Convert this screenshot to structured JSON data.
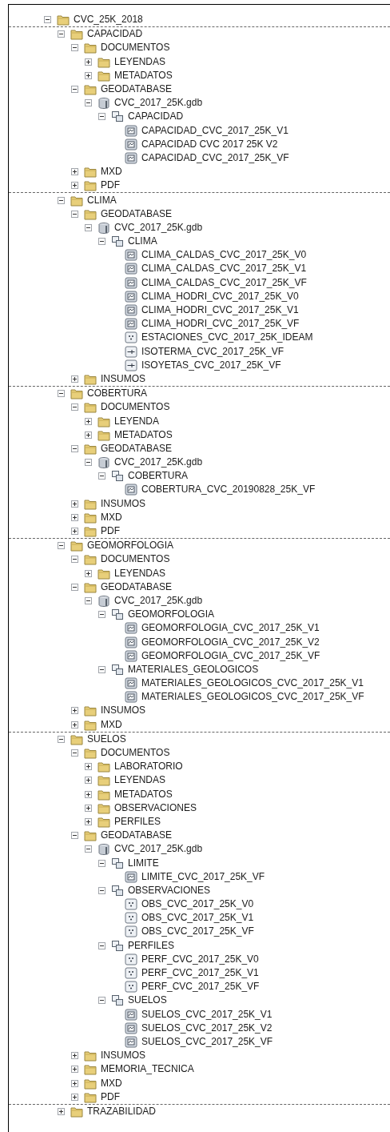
{
  "tree": {
    "label": "CVC_25K_2018",
    "kind": "folder",
    "expanded": true,
    "children": [
      {
        "label": "CAPACIDAD",
        "kind": "folder",
        "expanded": true,
        "children": [
          {
            "label": "DOCUMENTOS",
            "kind": "folder",
            "expanded": true,
            "children": [
              {
                "label": "LEYENDAS",
                "kind": "folder",
                "expanded": false
              },
              {
                "label": "METADATOS",
                "kind": "folder",
                "expanded": false
              }
            ]
          },
          {
            "label": "GEODATABASE",
            "kind": "folder",
            "expanded": true,
            "children": [
              {
                "label": "CVC_2017_25K.gdb",
                "kind": "geodatabase",
                "expanded": true,
                "children": [
                  {
                    "label": "CAPACIDAD",
                    "kind": "dataset",
                    "expanded": true,
                    "children": [
                      {
                        "label": "CAPACIDAD_CVC_2017_25K_V1",
                        "kind": "polygon"
                      },
                      {
                        "label": "CAPACIDAD CVC 2017 25K V2",
                        "kind": "polygon"
                      },
                      {
                        "label": "CAPACIDAD_CVC_2017_25K_VF",
                        "kind": "polygon"
                      }
                    ]
                  }
                ]
              }
            ]
          },
          {
            "label": "MXD",
            "kind": "folder",
            "expanded": false
          },
          {
            "label": "PDF",
            "kind": "folder",
            "expanded": false
          }
        ]
      },
      {
        "label": "CLIMA",
        "kind": "folder",
        "expanded": true,
        "children": [
          {
            "label": "GEODATABASE",
            "kind": "folder",
            "expanded": true,
            "children": [
              {
                "label": "CVC_2017_25K.gdb",
                "kind": "geodatabase",
                "expanded": true,
                "children": [
                  {
                    "label": "CLIMA",
                    "kind": "dataset",
                    "expanded": true,
                    "children": [
                      {
                        "label": "CLIMA_CALDAS_CVC_2017_25K_V0",
                        "kind": "polygon"
                      },
                      {
                        "label": "CLIMA_CALDAS_CVC_2017_25K_V1",
                        "kind": "polygon"
                      },
                      {
                        "label": "CLIMA_CALDAS_CVC_2017_25K_VF",
                        "kind": "polygon"
                      },
                      {
                        "label": "CLIMA_HODRI_CVC_2017_25K_V0",
                        "kind": "polygon"
                      },
                      {
                        "label": "CLIMA_HODRI_CVC_2017_25K_V1",
                        "kind": "polygon"
                      },
                      {
                        "label": "CLIMA_HODRI_CVC_2017_25K_VF",
                        "kind": "polygon"
                      },
                      {
                        "label": "ESTACIONES_CVC_2017_25K_IDEAM",
                        "kind": "point"
                      },
                      {
                        "label": "ISOTERMA_CVC_2017_25K_VF",
                        "kind": "line"
                      },
                      {
                        "label": "ISOYETAS_CVC_2017_25K_VF",
                        "kind": "line"
                      }
                    ]
                  }
                ]
              }
            ]
          },
          {
            "label": "INSUMOS",
            "kind": "folder",
            "expanded": false
          }
        ]
      },
      {
        "label": "COBERTURA",
        "kind": "folder",
        "expanded": true,
        "children": [
          {
            "label": "DOCUMENTOS",
            "kind": "folder",
            "expanded": true,
            "children": [
              {
                "label": "LEYENDA",
                "kind": "folder",
                "expanded": false
              },
              {
                "label": "METADATOS",
                "kind": "folder",
                "expanded": false
              }
            ]
          },
          {
            "label": "GEODATABASE",
            "kind": "folder",
            "expanded": true,
            "children": [
              {
                "label": "CVC_2017_25K.gdb",
                "kind": "geodatabase",
                "expanded": true,
                "children": [
                  {
                    "label": "COBERTURA",
                    "kind": "dataset",
                    "expanded": true,
                    "children": [
                      {
                        "label": "COBERTURA_CVC_20190828_25K_VF",
                        "kind": "polygon"
                      }
                    ]
                  }
                ]
              }
            ]
          },
          {
            "label": "INSUMOS",
            "kind": "folder",
            "expanded": false
          },
          {
            "label": "MXD",
            "kind": "folder",
            "expanded": false
          },
          {
            "label": "PDF",
            "kind": "folder",
            "expanded": false
          }
        ]
      },
      {
        "label": "GEOMORFOLOGIA",
        "kind": "folder",
        "expanded": true,
        "children": [
          {
            "label": "DOCUMENTOS",
            "kind": "folder",
            "expanded": true,
            "children": [
              {
                "label": "LEYENDAS",
                "kind": "folder",
                "expanded": false
              }
            ]
          },
          {
            "label": "GEODATABASE",
            "kind": "folder",
            "expanded": true,
            "children": [
              {
                "label": "CVC_2017_25K.gdb",
                "kind": "geodatabase",
                "expanded": true,
                "children": [
                  {
                    "label": "GEOMORFOLOGIA",
                    "kind": "dataset",
                    "expanded": true,
                    "children": [
                      {
                        "label": "GEOMORFOLOGIA_CVC_2017_25K_V1",
                        "kind": "polygon"
                      },
                      {
                        "label": "GEOMORFOLOGIA_CVC_2017_25K_V2",
                        "kind": "polygon"
                      },
                      {
                        "label": "GEOMORFOLOGIA_CVC_2017_25K_VF",
                        "kind": "polygon"
                      }
                    ]
                  },
                  {
                    "label": "MATERIALES_GEOLOGICOS",
                    "kind": "dataset",
                    "expanded": true,
                    "children": [
                      {
                        "label": "MATERIALES_GEOLOGICOS_CVC_2017_25K_V1",
                        "kind": "polygon"
                      },
                      {
                        "label": "MATERIALES_GEOLOGICOS_CVC_2017_25K_VF",
                        "kind": "polygon"
                      }
                    ]
                  }
                ]
              }
            ]
          },
          {
            "label": "INSUMOS",
            "kind": "folder",
            "expanded": false
          },
          {
            "label": "MXD",
            "kind": "folder",
            "expanded": false
          }
        ]
      },
      {
        "label": "SUELOS",
        "kind": "folder",
        "expanded": true,
        "children": [
          {
            "label": "DOCUMENTOS",
            "kind": "folder",
            "expanded": true,
            "children": [
              {
                "label": "LABORATORIO",
                "kind": "folder",
                "expanded": false
              },
              {
                "label": "LEYENDAS",
                "kind": "folder",
                "expanded": false
              },
              {
                "label": "METADATOS",
                "kind": "folder",
                "expanded": false
              },
              {
                "label": "OBSERVACIONES",
                "kind": "folder",
                "expanded": false
              },
              {
                "label": "PERFILES",
                "kind": "folder",
                "expanded": false
              }
            ]
          },
          {
            "label": "GEODATABASE",
            "kind": "folder",
            "expanded": true,
            "children": [
              {
                "label": "CVC_2017_25K.gdb",
                "kind": "geodatabase",
                "expanded": true,
                "children": [
                  {
                    "label": "LIMITE",
                    "kind": "dataset",
                    "expanded": true,
                    "children": [
                      {
                        "label": "LIMITE_CVC_2017_25K_VF",
                        "kind": "polygon"
                      }
                    ]
                  },
                  {
                    "label": "OBSERVACIONES",
                    "kind": "dataset",
                    "expanded": true,
                    "children": [
                      {
                        "label": "OBS_CVC_2017_25K_V0",
                        "kind": "point"
                      },
                      {
                        "label": "OBS_CVC_2017_25K_V1",
                        "kind": "point"
                      },
                      {
                        "label": "OBS_CVC_2017_25K_VF",
                        "kind": "point"
                      }
                    ]
                  },
                  {
                    "label": "PERFILES",
                    "kind": "dataset",
                    "expanded": true,
                    "children": [
                      {
                        "label": "PERF_CVC_2017_25K_V0",
                        "kind": "point"
                      },
                      {
                        "label": "PERF_CVC_2017_25K_V1",
                        "kind": "point"
                      },
                      {
                        "label": "PERF_CVC_2017_25K_VF",
                        "kind": "point"
                      }
                    ]
                  },
                  {
                    "label": "SUELOS",
                    "kind": "dataset",
                    "expanded": true,
                    "children": [
                      {
                        "label": "SUELOS_CVC_2017_25K_V1",
                        "kind": "polygon"
                      },
                      {
                        "label": "SUELOS_CVC_2017_25K_V2",
                        "kind": "polygon"
                      },
                      {
                        "label": "SUELOS_CVC_2017_25K_VF",
                        "kind": "polygon"
                      }
                    ]
                  }
                ]
              }
            ]
          },
          {
            "label": "INSUMOS",
            "kind": "folder",
            "expanded": false
          },
          {
            "label": "MEMORIA_TECNICA",
            "kind": "folder",
            "expanded": false
          },
          {
            "label": "MXD",
            "kind": "folder",
            "expanded": false
          },
          {
            "label": "PDF",
            "kind": "folder",
            "expanded": false
          }
        ]
      },
      {
        "label": "TRAZABILIDAD",
        "kind": "folder",
        "expanded": false
      }
    ]
  }
}
